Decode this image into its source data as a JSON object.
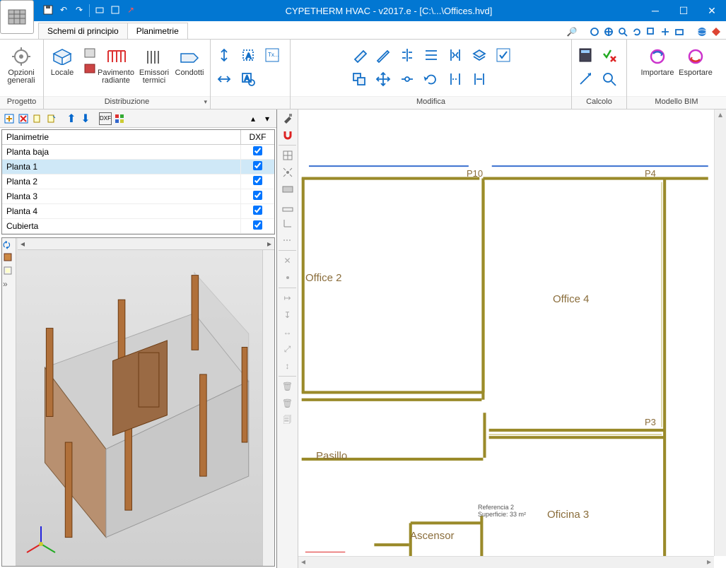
{
  "title": "CYPETHERM HVAC - v2017.e - [C:\\...\\Offices.hvd]",
  "tabs": {
    "schemi": "Schemi di principio",
    "planimetrie": "Planimetrie"
  },
  "ribbon": {
    "opzioni": "Opzioni generali",
    "locale": "Locale",
    "pavimento": "Pavimento radiante",
    "emissori": "Emissori termici",
    "condotti": "Condotti",
    "group_progetto": "Progetto",
    "group_distribuzione": "Distribuzione",
    "group_modifica": "Modifica",
    "group_calcolo": "Calcolo",
    "importare": "Importare",
    "esportare": "Esportare",
    "group_bim": "Modello BIM"
  },
  "tree": {
    "header_name": "Planimetrie",
    "header_dxf": "DXF",
    "rows": [
      {
        "name": "Planta baja",
        "dxf": true,
        "selected": false
      },
      {
        "name": "Planta 1",
        "dxf": true,
        "selected": true
      },
      {
        "name": "Planta 2",
        "dxf": true,
        "selected": false
      },
      {
        "name": "Planta 3",
        "dxf": true,
        "selected": false
      },
      {
        "name": "Planta 4",
        "dxf": true,
        "selected": false
      },
      {
        "name": "Cubierta",
        "dxf": true,
        "selected": false
      }
    ]
  },
  "floorplan": {
    "office2": "Office 2",
    "office4": "Office 4",
    "pasillo": "Pasillo",
    "ascensor": "Ascensor",
    "oficina3": "Oficina 3",
    "p10": "P10",
    "p4": "P4",
    "p3": "P3",
    "ref_line1": "Referencia 2",
    "ref_line2": "Superficie: 33 m²"
  }
}
